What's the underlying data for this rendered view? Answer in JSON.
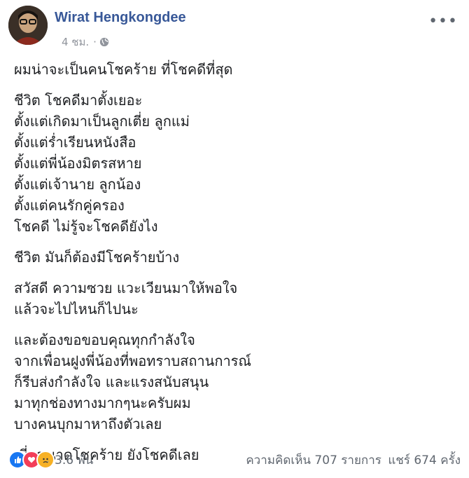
{
  "post": {
    "author": "Wirat Hengkongdee",
    "time": "4 ชม.",
    "privacy_icon": "globe-icon",
    "menu_icon": "more-horizontal-icon",
    "paragraphs": [
      [
        "ผมน่าจะเป็นคนโชคร้าย ที่โชคดีที่สุด"
      ],
      [
        "ชีวิต โชคดีมาตั้งเยอะ",
        "ตั้งแต่เกิดมาเป็นลูกเตี่ย ลูกแม่",
        "ตั้งแต่ร่ำเรียนหนังสือ",
        "ตั้งแต่พี่น้องมิตรสหาย",
        "ตั้งแต่เจ้านาย ลูกน้อง",
        "ตั้งแต่คนรักคู่ครอง",
        "โชคดี ไม่รู้จะโชคดียังไง"
      ],
      [
        "ชีวิต มันก็ต้องมีโชคร้ายบ้าง"
      ],
      [
        "สวัสดี ความซวย แวะเวียนมาให้พอใจ",
        "แล้วจะไปไหนก็ไปนะ"
      ],
      [
        "และต้องขอขอบคุณทุกกำลังใจ",
        "จากเพื่อนฝูงพี่น้องที่พอทราบสถานการณ์",
        "ก็รีบส่งกำลังใจ และแรงสนับสนุน",
        "มาทุกช่องทางมากๆนะครับผม",
        "บางคนบุกมาหาถึงตัวเลย"
      ],
      [
        "เนี่ยขนาดโชคร้าย ยังโชคดีเลย"
      ]
    ],
    "reactions": {
      "icons": [
        "like-icon",
        "love-icon",
        "sad-icon"
      ],
      "count": "3.6 พัน"
    },
    "comments": "ความคิดเห็น 707 รายการ",
    "shares": "แชร์ 674 ครั้ง",
    "colors": {
      "author": "#385898",
      "meta": "#90949c",
      "like": "#1877f2",
      "love": "#f33e58",
      "sad": "#f7b125"
    }
  }
}
